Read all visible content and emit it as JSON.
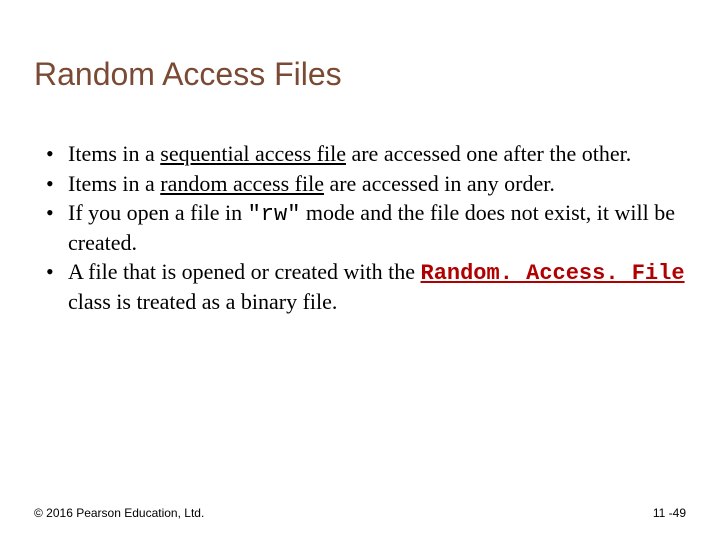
{
  "title": "Random Access Files",
  "bullets": {
    "b1a": "Items in a ",
    "b1u": "sequential access file",
    "b1b": " are accessed one after the other.",
    "b2a": "Items in a ",
    "b2u": "random access file",
    "b2b": " are accessed in any order.",
    "b3a": "If you open a file in ",
    "b3q": "\"rw\"",
    "b3b": " mode and the file does not exist, it will be created.",
    "b4a": "A file that is opened or created with the ",
    "b4code": "Random. Access. File",
    "b4b": " class is treated as a binary file."
  },
  "footer": {
    "copyright": "© 2016 Pearson Education, Ltd.",
    "page": "11 -49"
  }
}
